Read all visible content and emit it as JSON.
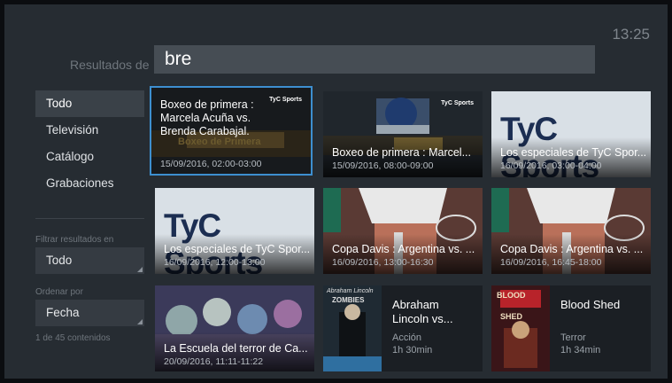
{
  "clock": "13:25",
  "search": {
    "label": "Resultados de",
    "query": "bre"
  },
  "sidebar": {
    "items": [
      {
        "label": "Todo"
      },
      {
        "label": "Televisión"
      },
      {
        "label": "Catálogo"
      },
      {
        "label": "Grabaciones"
      }
    ]
  },
  "filter": {
    "label": "Filtrar resultados en",
    "value": "Todo"
  },
  "sort": {
    "label": "Ordenar por",
    "value": "Fecha"
  },
  "count": "1 de 45 contenidos",
  "results": [
    {
      "title": "Boxeo de primera :",
      "title2": "Marcela Acuña vs.",
      "title3": "Brenda Carabajal.",
      "subtitle": "15/09/2016, 02:00-03:00",
      "badge": "TyC Sports",
      "overlay": "Boxeo de Primera"
    },
    {
      "title": "Boxeo de primera : Marcel...",
      "subtitle": "15/09/2016, 08:00-09:00",
      "badge": "TyC Sports"
    },
    {
      "title": "Los especiales de TyC Spor...",
      "subtitle": "16/09/2016, 03:00-04:00",
      "logo": "TyC Sports"
    },
    {
      "title": "Los especiales de TyC Spor...",
      "subtitle": "16/09/2016, 12:00-13:00",
      "logo": "TyC Sports"
    },
    {
      "title": "Copa Davis : Argentina vs. ...",
      "subtitle": "16/09/2016, 13:00-16:30"
    },
    {
      "title": "Copa Davis : Argentina vs. ...",
      "subtitle": "16/09/2016, 16:45-18:00"
    },
    {
      "title": "La Escuela del terror de Ca...",
      "subtitle": "20/09/2016, 11:11-11:22"
    },
    {
      "title": "Abraham",
      "title2": "Lincoln vs...",
      "genre": "Acción",
      "duration": "1h 30min",
      "poster_text": "Abraham Lincoln",
      "poster_text2": "ZOMBIES"
    },
    {
      "title": "Blood Shed",
      "genre": "Terror",
      "duration": "1h 34min",
      "poster_text": "BLOOD",
      "poster_text2": "SHED"
    }
  ],
  "colors": {
    "focus": "#3d8fd0",
    "background": "#262c32",
    "search_box": "#464d54"
  }
}
